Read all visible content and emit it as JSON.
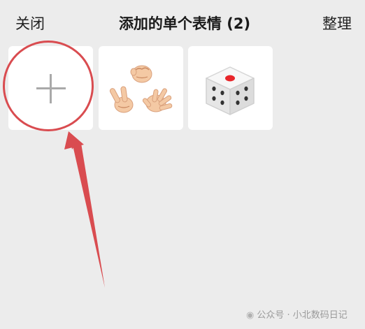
{
  "header": {
    "close_label": "关闭",
    "title": "添加的单个表情 (2)",
    "organize_label": "整理"
  },
  "tiles": [
    {
      "name": "add-sticker",
      "icon": "plus-icon"
    },
    {
      "name": "rock-paper-scissors",
      "icon": "rock-paper-scissors-icon"
    },
    {
      "name": "dice",
      "icon": "dice-icon"
    }
  ],
  "annotation": {
    "color": "#d94c50"
  },
  "watermark": {
    "text": "公众号 · 小北数码日记"
  }
}
